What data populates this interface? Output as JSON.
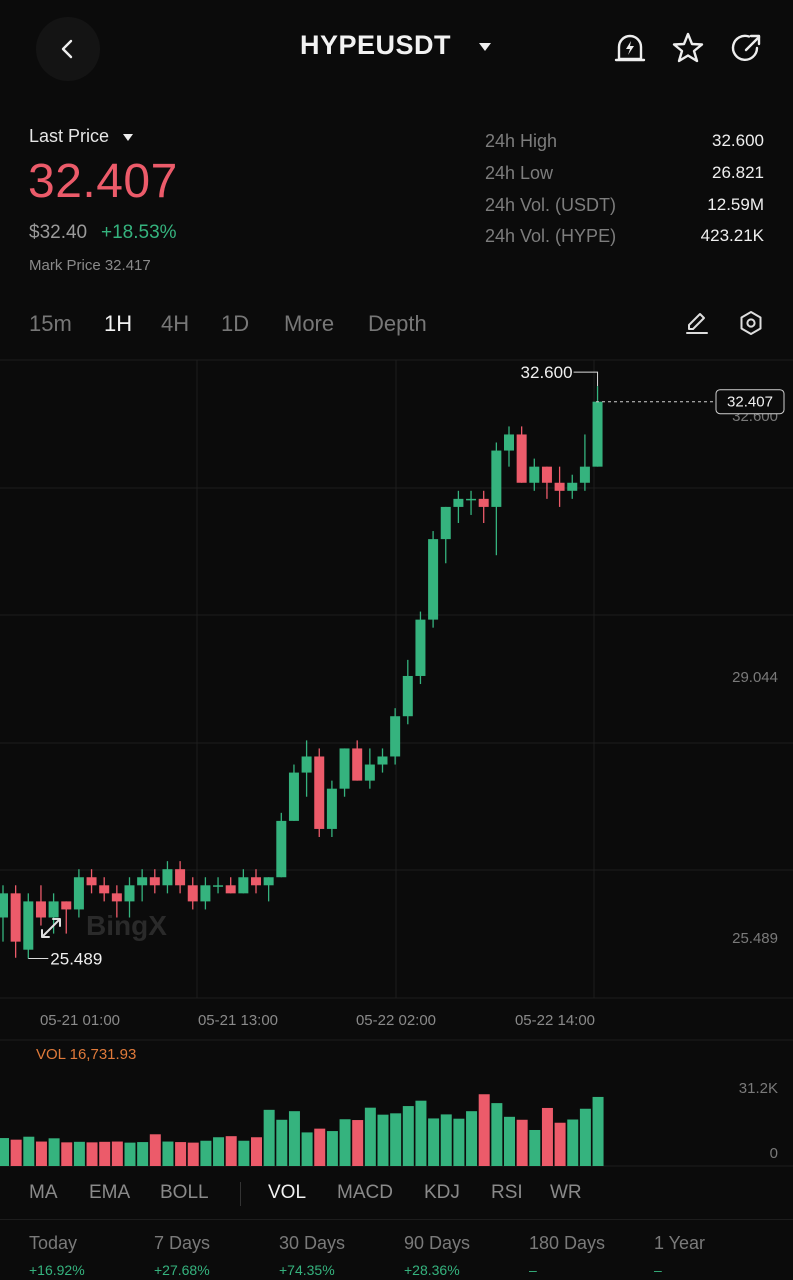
{
  "header": {
    "symbol": "HYPEUSDT"
  },
  "price": {
    "label": "Last Price",
    "last": "32.407",
    "usd": "$32.40",
    "change_pct": "+18.53%",
    "mark": "Mark Price 32.417"
  },
  "stats": [
    {
      "label": "24h High",
      "value": "32.600"
    },
    {
      "label": "24h Low",
      "value": "26.821"
    },
    {
      "label": "24h Vol. (USDT)",
      "value": "12.59M"
    },
    {
      "label": "24h Vol. (HYPE)",
      "value": "423.21K"
    }
  ],
  "timeframes": {
    "t15m": "15m",
    "t1h": "1H",
    "t4h": "4H",
    "t1d": "1D",
    "more": "More",
    "depth": "Depth"
  },
  "indicators": {
    "ma": "MA",
    "ema": "EMA",
    "boll": "BOLL",
    "vol": "VOL",
    "macd": "MACD",
    "kdj": "KDJ",
    "rsi": "RSI",
    "wr": "WR"
  },
  "volume": {
    "label": "VOL 16,731.93",
    "axis_top": "31.2K",
    "axis_zero": "0"
  },
  "periods": [
    {
      "label": "Today",
      "value": "+16.92%"
    },
    {
      "label": "7 Days",
      "value": "+27.68%"
    },
    {
      "label": "30 Days",
      "value": "+74.35%"
    },
    {
      "label": "90 Days",
      "value": "+28.36%"
    },
    {
      "label": "180 Days",
      "value": "–"
    },
    {
      "label": "1 Year",
      "value": "–"
    }
  ],
  "colors": {
    "up": "#35b37e",
    "down": "#ec5b6a",
    "accent_vol": "#e07a3a"
  },
  "chart_data": {
    "type": "candlestick",
    "title": "",
    "watermark": "BingX",
    "y_axis_labels": [
      "32.600",
      "29.044",
      "25.489"
    ],
    "current_price_tag": "32.407",
    "high_marker": "32.600",
    "low_marker": "25.489",
    "x_tick_labels": [
      "05-21 01:00",
      "05-21 13:00",
      "05-22 02:00",
      "05-22 14:00"
    ],
    "ylim": [
      25.0,
      32.9
    ],
    "candles": [
      {
        "o": 26.0,
        "h": 26.4,
        "l": 25.7,
        "c": 26.3
      },
      {
        "o": 26.3,
        "h": 26.4,
        "l": 25.5,
        "c": 25.7
      },
      {
        "o": 25.6,
        "h": 26.3,
        "l": 25.49,
        "c": 26.2
      },
      {
        "o": 26.2,
        "h": 26.4,
        "l": 25.9,
        "c": 26.0
      },
      {
        "o": 26.0,
        "h": 26.3,
        "l": 25.8,
        "c": 26.2
      },
      {
        "o": 26.2,
        "h": 26.2,
        "l": 25.8,
        "c": 26.1
      },
      {
        "o": 26.1,
        "h": 26.6,
        "l": 26.0,
        "c": 26.5
      },
      {
        "o": 26.5,
        "h": 26.6,
        "l": 26.3,
        "c": 26.4
      },
      {
        "o": 26.4,
        "h": 26.5,
        "l": 26.2,
        "c": 26.3
      },
      {
        "o": 26.3,
        "h": 26.4,
        "l": 26.0,
        "c": 26.2
      },
      {
        "o": 26.2,
        "h": 26.5,
        "l": 26.0,
        "c": 26.4
      },
      {
        "o": 26.4,
        "h": 26.6,
        "l": 26.2,
        "c": 26.5
      },
      {
        "o": 26.5,
        "h": 26.6,
        "l": 26.3,
        "c": 26.4
      },
      {
        "o": 26.4,
        "h": 26.7,
        "l": 26.3,
        "c": 26.6
      },
      {
        "o": 26.6,
        "h": 26.7,
        "l": 26.3,
        "c": 26.4
      },
      {
        "o": 26.4,
        "h": 26.5,
        "l": 26.1,
        "c": 26.2
      },
      {
        "o": 26.2,
        "h": 26.5,
        "l": 26.1,
        "c": 26.4
      },
      {
        "o": 26.4,
        "h": 26.5,
        "l": 26.3,
        "c": 26.4
      },
      {
        "o": 26.4,
        "h": 26.5,
        "l": 26.3,
        "c": 26.3
      },
      {
        "o": 26.3,
        "h": 26.6,
        "l": 26.3,
        "c": 26.5
      },
      {
        "o": 26.5,
        "h": 26.6,
        "l": 26.3,
        "c": 26.4
      },
      {
        "o": 26.4,
        "h": 26.5,
        "l": 26.2,
        "c": 26.5
      },
      {
        "o": 26.5,
        "h": 27.3,
        "l": 26.5,
        "c": 27.2
      },
      {
        "o": 27.2,
        "h": 27.9,
        "l": 27.2,
        "c": 27.8
      },
      {
        "o": 27.8,
        "h": 28.2,
        "l": 27.5,
        "c": 28.0
      },
      {
        "o": 28.0,
        "h": 28.1,
        "l": 27.0,
        "c": 27.1
      },
      {
        "o": 27.1,
        "h": 27.7,
        "l": 27.0,
        "c": 27.6
      },
      {
        "o": 27.6,
        "h": 28.1,
        "l": 27.5,
        "c": 28.1
      },
      {
        "o": 28.1,
        "h": 28.2,
        "l": 27.7,
        "c": 27.7
      },
      {
        "o": 27.7,
        "h": 28.1,
        "l": 27.6,
        "c": 27.9
      },
      {
        "o": 27.9,
        "h": 28.1,
        "l": 27.8,
        "c": 28.0
      },
      {
        "o": 28.0,
        "h": 28.6,
        "l": 27.9,
        "c": 28.5
      },
      {
        "o": 28.5,
        "h": 29.2,
        "l": 28.4,
        "c": 29.0
      },
      {
        "o": 29.0,
        "h": 29.8,
        "l": 28.9,
        "c": 29.7
      },
      {
        "o": 29.7,
        "h": 30.8,
        "l": 29.6,
        "c": 30.7
      },
      {
        "o": 30.7,
        "h": 31.1,
        "l": 30.4,
        "c": 31.1
      },
      {
        "o": 31.1,
        "h": 31.3,
        "l": 30.9,
        "c": 31.2
      },
      {
        "o": 31.2,
        "h": 31.3,
        "l": 31.0,
        "c": 31.2
      },
      {
        "o": 31.2,
        "h": 31.3,
        "l": 30.9,
        "c": 31.1
      },
      {
        "o": 31.1,
        "h": 31.9,
        "l": 30.5,
        "c": 31.8
      },
      {
        "o": 31.8,
        "h": 32.1,
        "l": 31.6,
        "c": 32.0
      },
      {
        "o": 32.0,
        "h": 32.1,
        "l": 31.4,
        "c": 31.4
      },
      {
        "o": 31.4,
        "h": 31.7,
        "l": 31.3,
        "c": 31.6
      },
      {
        "o": 31.6,
        "h": 31.6,
        "l": 31.2,
        "c": 31.4
      },
      {
        "o": 31.4,
        "h": 31.6,
        "l": 31.1,
        "c": 31.3
      },
      {
        "o": 31.3,
        "h": 31.5,
        "l": 31.2,
        "c": 31.4
      },
      {
        "o": 31.4,
        "h": 32.0,
        "l": 31.3,
        "c": 31.6
      },
      {
        "o": 31.6,
        "h": 32.6,
        "l": 31.6,
        "c": 32.407
      }
    ],
    "volume_ylim": [
      0,
      32000
    ],
    "volumes": [
      10400,
      9800,
      10900,
      9100,
      10300,
      8800,
      9000,
      8800,
      9000,
      9100,
      8700,
      8900,
      11800,
      9100,
      8900,
      8700,
      9400,
      10700,
      11100,
      9400,
      10700,
      20900,
      17200,
      20400,
      12500,
      13900,
      13000,
      17400,
      17100,
      21700,
      19100,
      19600,
      22300,
      24300,
      17700,
      19200,
      17600,
      20400,
      26700,
      23400,
      18300,
      17200,
      13400,
      21600,
      16100,
      17300,
      21300,
      25700
    ]
  }
}
